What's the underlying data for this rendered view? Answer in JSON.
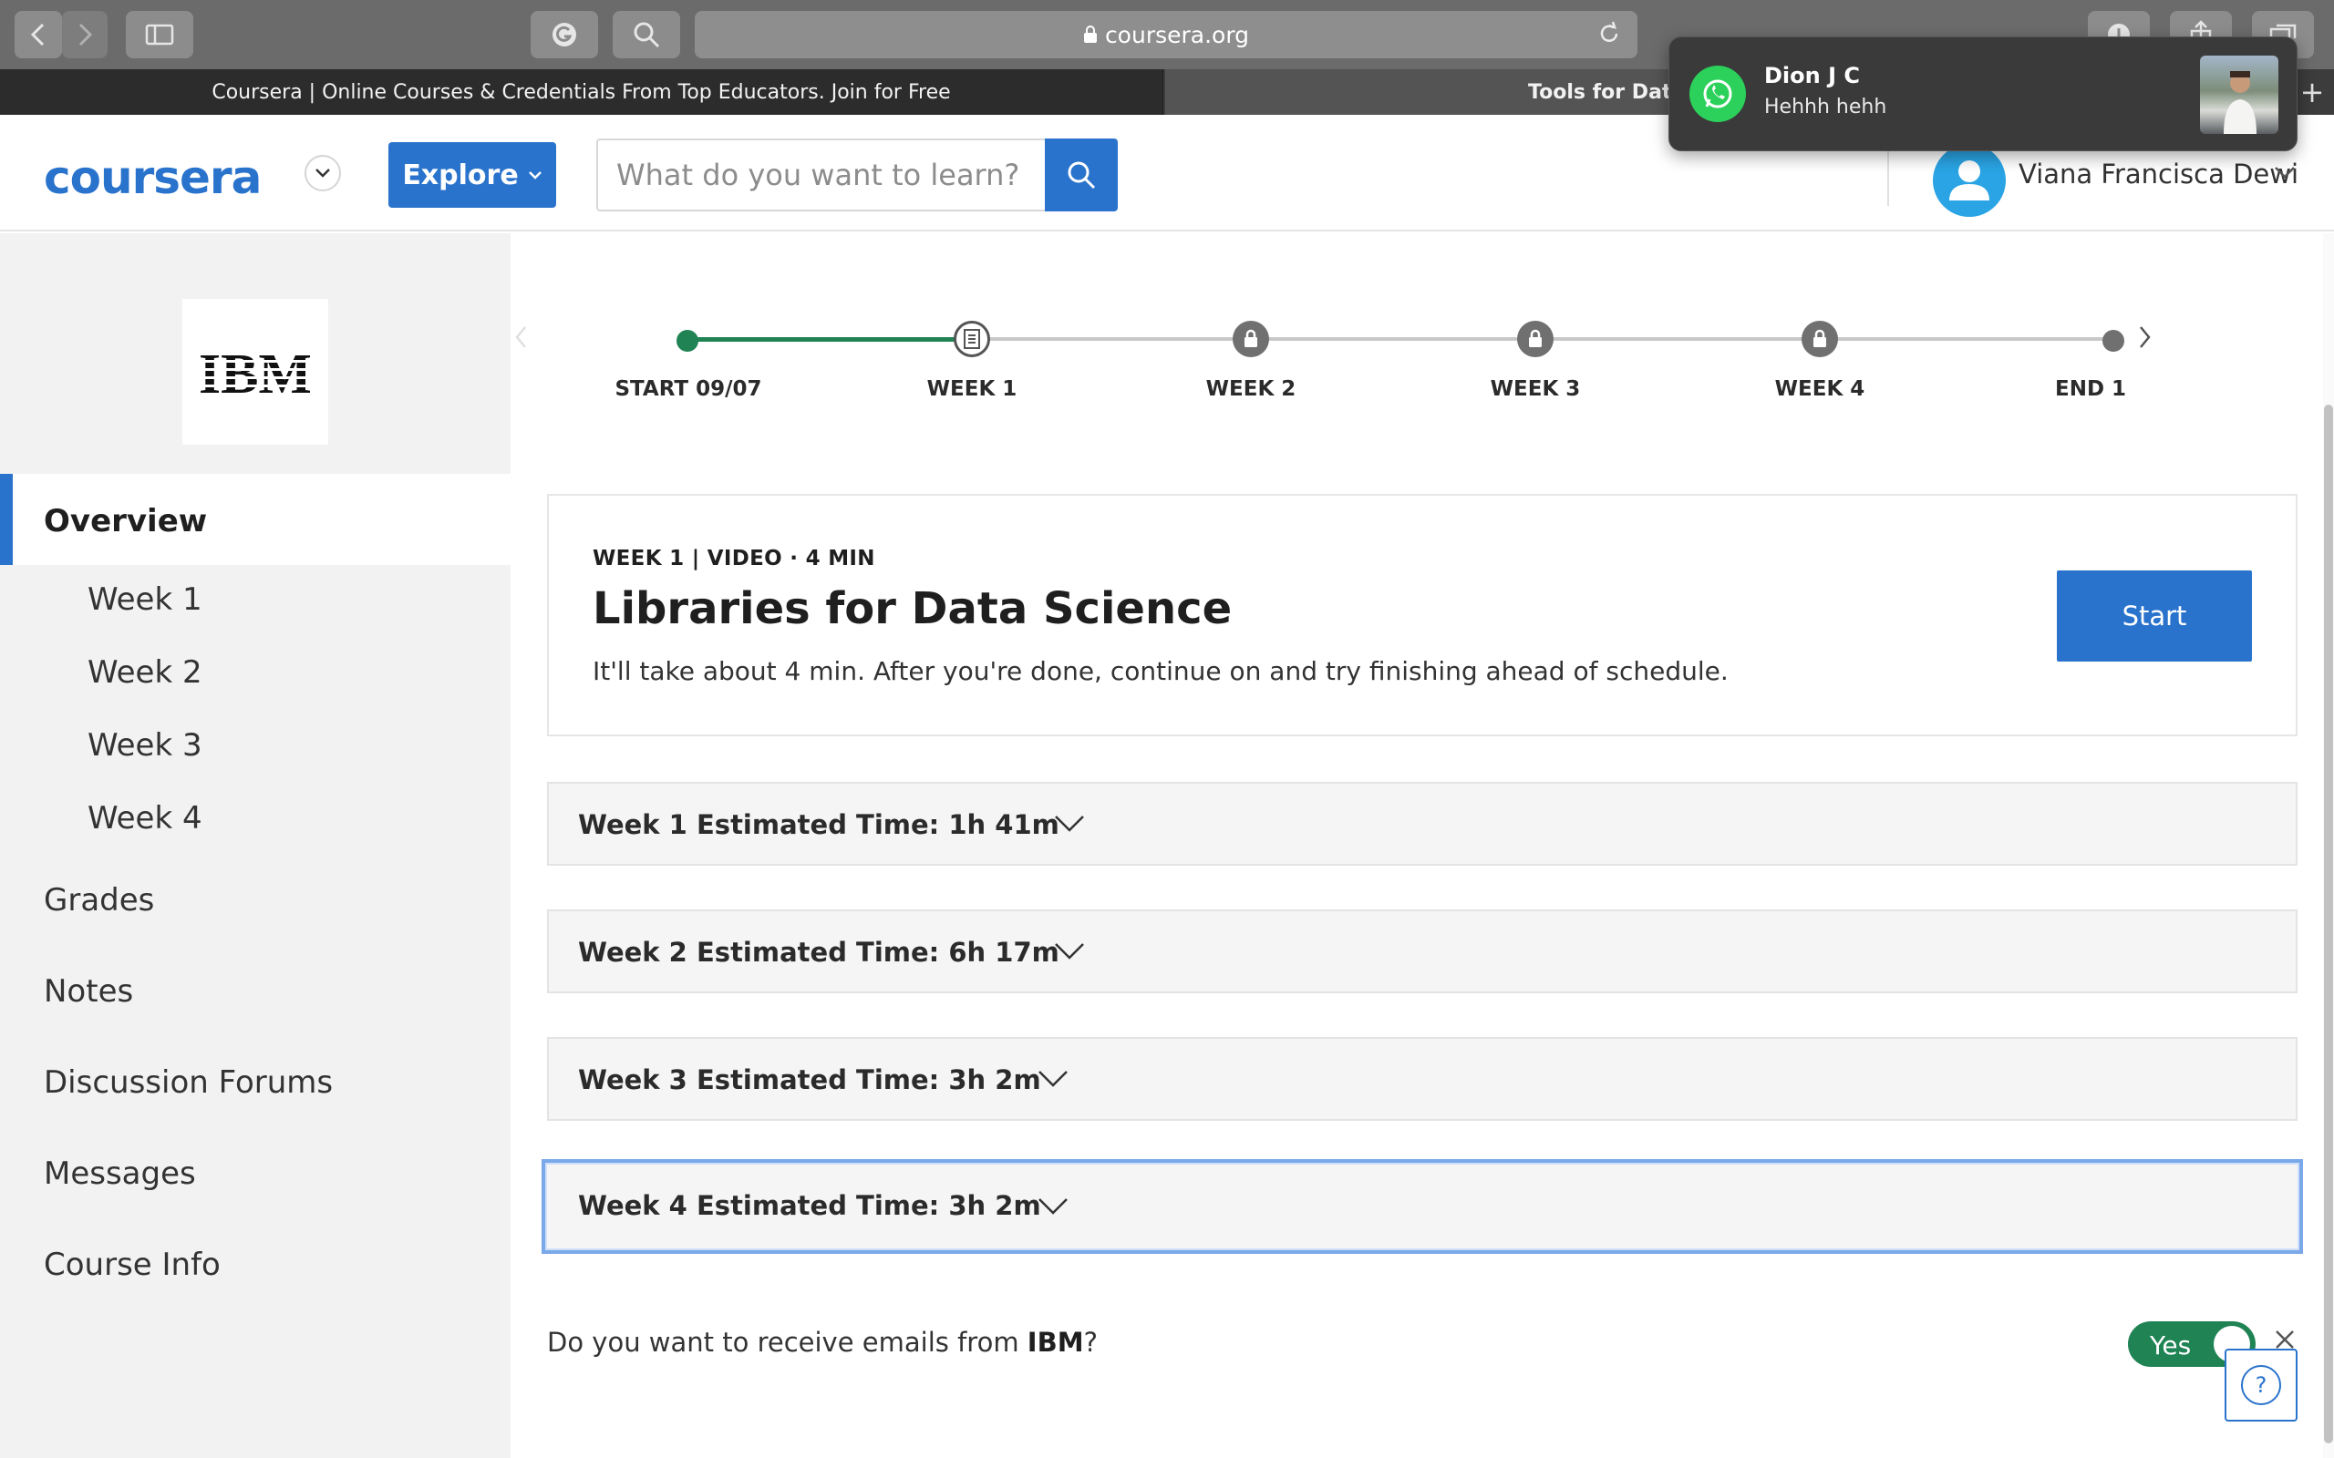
{
  "browser": {
    "url": "coursera.org",
    "tabs": [
      {
        "label": "Coursera | Online Courses & Credentials From Top Educators. Join for Free"
      },
      {
        "label": "Tools for Data"
      }
    ],
    "new_tab_glyph": "+",
    "icons": [
      "back-icon",
      "forward-icon",
      "sidebar-icon",
      "grammarly-icon",
      "search-icon",
      "lock-icon",
      "reload-icon",
      "download-icon",
      "share-icon",
      "tabs-icon"
    ]
  },
  "notification": {
    "app": "WhatsApp",
    "sender": "Dion J C",
    "message": "Hehhh hehh"
  },
  "header": {
    "logo_text": "coursera",
    "explore_label": "Explore",
    "search_placeholder": "What do you want to learn?",
    "user_name": "Viana Francisca Dewi"
  },
  "sidebar": {
    "partner_logo_text": "IBM",
    "overview_label": "Overview",
    "week_items": [
      {
        "label": "Week 1"
      },
      {
        "label": "Week 2"
      },
      {
        "label": "Week 3"
      },
      {
        "label": "Week 4"
      }
    ],
    "main_items": [
      {
        "label": "Grades"
      },
      {
        "label": "Notes"
      },
      {
        "label": "Discussion Forums"
      },
      {
        "label": "Messages"
      },
      {
        "label": "Course Info"
      }
    ]
  },
  "timeline": {
    "milestones": [
      {
        "label": "START 09/07",
        "state": "completed"
      },
      {
        "label": "WEEK 1",
        "state": "current"
      },
      {
        "label": "WEEK 2",
        "state": "locked"
      },
      {
        "label": "WEEK 3",
        "state": "locked"
      },
      {
        "label": "WEEK 4",
        "state": "locked"
      },
      {
        "label": "END 1(",
        "state": "end"
      }
    ]
  },
  "next_item": {
    "meta": "WEEK 1 | VIDEO · 4 MIN",
    "title": "Libraries for Data Science",
    "description": "It'll take about 4 min. After you're done, continue on and try finishing ahead of schedule.",
    "start_label": "Start"
  },
  "weeks": [
    {
      "name": "Week 1",
      "time": "Estimated Time: 1h 41m"
    },
    {
      "name": "Week 2",
      "time": "Estimated Time: 6h 17m"
    },
    {
      "name": "Week 3",
      "time": "Estimated Time: 3h 2m"
    },
    {
      "name": "Week 4",
      "time": "Estimated Time: 3h 2m"
    }
  ],
  "email_prompt": {
    "text_before": "Do you want to receive emails from ",
    "org": "IBM",
    "text_after": "?",
    "toggle_label": "Yes",
    "toggle_on": true
  },
  "help_label": "?",
  "colors": {
    "brand_blue": "#2a73cc",
    "progress_green": "#1f8354",
    "whatsapp_green": "#2bd15a"
  }
}
